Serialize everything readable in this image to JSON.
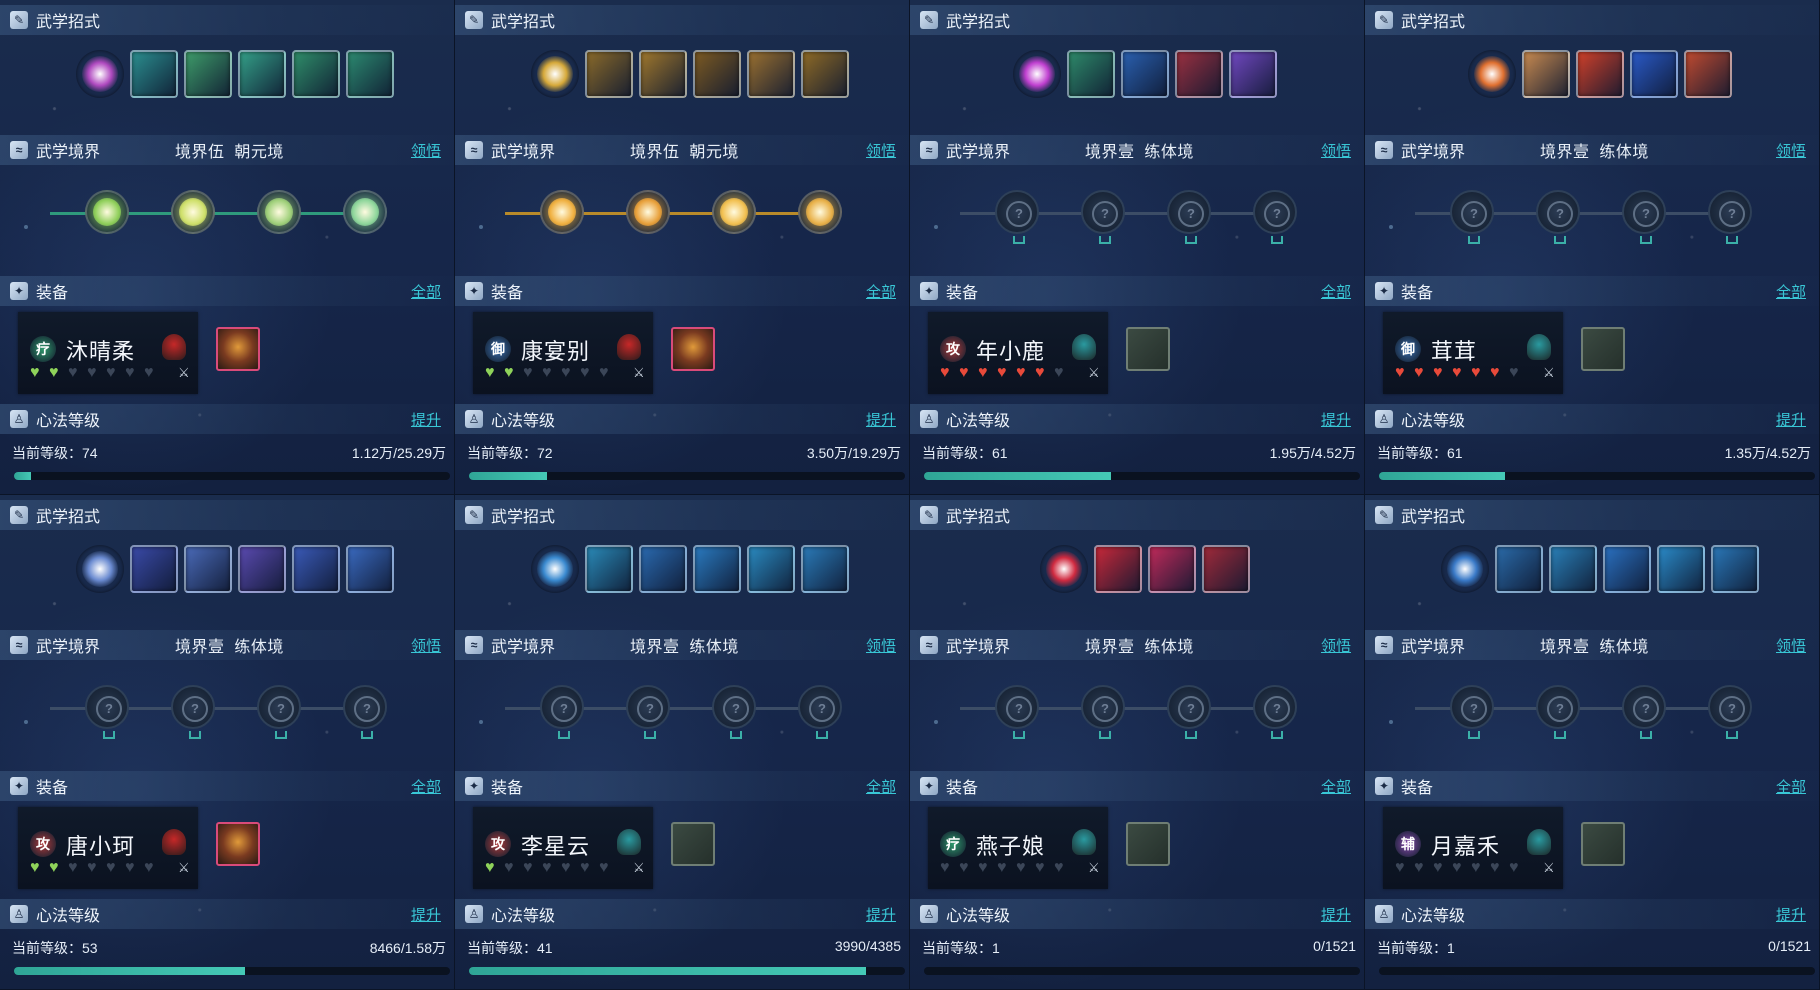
{
  "labels": {
    "moves": "武学招式",
    "realm": "武学境界",
    "equip": "装备",
    "method": "心法等级",
    "realm_link": "领悟",
    "equip_link": "全部",
    "method_link": "提升",
    "current_level_prefix": "当前等级："
  },
  "cards": [
    {
      "name": "沐晴柔",
      "role": "疗",
      "role_color": "#2f9a6c",
      "elem_color": "#c62828",
      "realm_level": "境界伍",
      "realm_stage": "朝元境",
      "realm_unlocked": true,
      "theme": "#2f9a7c",
      "first_color": "#b04ac0",
      "move_colors": [
        "#2b8f8f",
        "#3e9c6a",
        "#34a088",
        "#2f8e6a",
        "#2c8a70"
      ],
      "node_colors": [
        "#8fcf5a",
        "#cfe06a",
        "#9fd07a",
        "#8ed69b"
      ],
      "hearts": [
        "g",
        "g",
        "e",
        "e",
        "e",
        "e",
        "e"
      ],
      "eq2": "filled",
      "level": "74",
      "exp": "1.12万/25.29万",
      "progress": 0.04
    },
    {
      "name": "康宴别",
      "role": "御",
      "role_color": "#3a6fb0",
      "elem_color": "#c62828",
      "realm_level": "境界伍",
      "realm_stage": "朝元境",
      "realm_unlocked": true,
      "theme": "#b88a2a",
      "first_color": "#d6a93a",
      "move_colors": [
        "#8a6a2a",
        "#a0782c",
        "#7c5a22",
        "#9a7030",
        "#8e6a26"
      ],
      "node_colors": [
        "#f0b040",
        "#e8a03a",
        "#f2c050",
        "#e8b048"
      ],
      "hearts": [
        "g",
        "g",
        "e",
        "e",
        "e",
        "e",
        "e"
      ],
      "eq2": "filled",
      "level": "72",
      "exp": "3.50万/19.29万",
      "progress": 0.18
    },
    {
      "name": "年小鹿",
      "role": "攻",
      "role_color": "#b03a3a",
      "elem_color": "#2a9aa0",
      "realm_level": "境界壹",
      "realm_stage": "练体境",
      "realm_unlocked": false,
      "theme": "#6a4ac8",
      "first_color": "#c040d0",
      "move_colors": [
        "#2e8a6a",
        "#2a60b0",
        "#9a3040",
        "#7048c0"
      ],
      "node_colors": [],
      "hearts": [
        "r",
        "r",
        "r",
        "r",
        "r",
        "r",
        "e"
      ],
      "eq2": "empty",
      "level": "61",
      "exp": "1.95万/4.52万",
      "progress": 0.43
    },
    {
      "name": "茸茸",
      "role": "御",
      "role_color": "#3a6fb0",
      "elem_color": "#2a9aa0",
      "realm_level": "境界壹",
      "realm_stage": "练体境",
      "realm_unlocked": false,
      "theme": "#d06a2a",
      "first_color": "#e07030",
      "move_colors": [
        "#c88a50",
        "#d0402a",
        "#2a5ac8",
        "#c04a30"
      ],
      "node_colors": [],
      "hearts": [
        "r",
        "r",
        "r",
        "r",
        "r",
        "r",
        "e"
      ],
      "eq2": "empty",
      "level": "61",
      "exp": "1.35万/4.52万",
      "progress": 0.29
    },
    {
      "name": "唐小珂",
      "role": "攻",
      "role_color": "#b03a3a",
      "elem_color": "#c62828",
      "realm_level": "境界壹",
      "realm_stage": "练体境",
      "realm_unlocked": false,
      "theme": "#4a5ab8",
      "first_color": "#6a8ad0",
      "move_colors": [
        "#3a4aa8",
        "#4a6ab8",
        "#5a4ab0",
        "#3a5ab8",
        "#3a6ac0"
      ],
      "node_colors": [],
      "hearts": [
        "g",
        "g",
        "e",
        "e",
        "e",
        "e",
        "e"
      ],
      "eq2": "filled",
      "level": "53",
      "exp": "8466/1.58万",
      "progress": 0.53
    },
    {
      "name": "李星云",
      "role": "攻",
      "role_color": "#b03a3a",
      "elem_color": "#2a9aa0",
      "realm_level": "境界壹",
      "realm_stage": "练体境",
      "realm_unlocked": false,
      "theme": "#2a7ab0",
      "first_color": "#3a8ad0",
      "move_colors": [
        "#2a8ab8",
        "#2a6ab0",
        "#2a7ac0",
        "#2a8ac0",
        "#2a7ab8"
      ],
      "node_colors": [],
      "hearts": [
        "g",
        "e",
        "e",
        "e",
        "e",
        "e",
        "e"
      ],
      "eq2": "empty",
      "level": "41",
      "exp": "3990/4385",
      "progress": 0.91
    },
    {
      "name": "燕子娘",
      "role": "疗",
      "role_color": "#2f9a6c",
      "elem_color": "#2a9aa0",
      "realm_level": "境界壹",
      "realm_stage": "练体境",
      "realm_unlocked": false,
      "theme": "#c8284a",
      "first_color": "#d02a40",
      "move_colors": [
        "#c8283a",
        "#c02a5a",
        "#a02a3a"
      ],
      "node_colors": [],
      "hearts": [
        "e",
        "e",
        "e",
        "e",
        "e",
        "e",
        "e"
      ],
      "eq2": "empty",
      "level": "1",
      "exp": "0/1521",
      "progress": 0.0
    },
    {
      "name": "月嘉禾",
      "role": "辅",
      "role_color": "#8a4ab0",
      "elem_color": "#2a9aa0",
      "realm_level": "境界壹",
      "realm_stage": "练体境",
      "realm_unlocked": false,
      "theme": "#2a80b8",
      "first_color": "#3a7ac8",
      "move_colors": [
        "#2a6aa8",
        "#2a80b8",
        "#2a70c0",
        "#2a8ac8",
        "#2a78b8"
      ],
      "node_colors": [],
      "hearts": [
        "e",
        "e",
        "e",
        "e",
        "e",
        "e",
        "e"
      ],
      "eq2": "empty",
      "level": "1",
      "exp": "0/1521",
      "progress": 0.0
    }
  ]
}
